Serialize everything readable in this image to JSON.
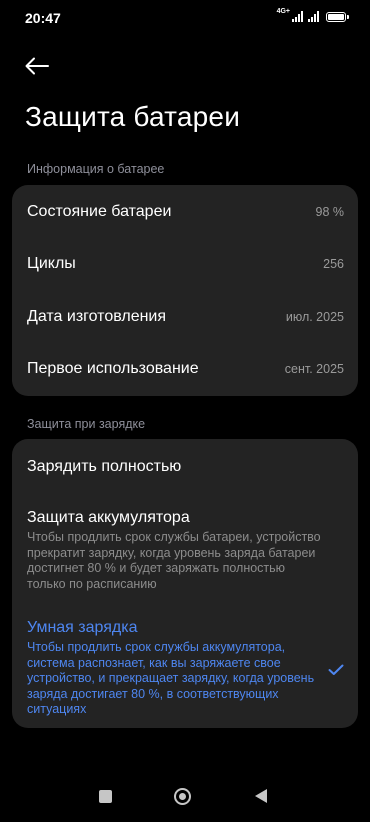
{
  "status_bar": {
    "time": "20:47",
    "network_label": "4G+"
  },
  "header": {
    "title": "Защита батареи"
  },
  "battery_info": {
    "section_title": "Информация о батарее",
    "rows": [
      {
        "label": "Состояние батареи",
        "value": "98 %"
      },
      {
        "label": "Циклы",
        "value": "256"
      },
      {
        "label": "Дата изготовления",
        "value": "июл. 2025"
      },
      {
        "label": "Первое использование",
        "value": "сент. 2025"
      }
    ]
  },
  "charging_protection": {
    "section_title": "Защита при зарядке",
    "options": [
      {
        "title": "Зарядить полностью",
        "description": "",
        "selected": false
      },
      {
        "title": "Защита аккумулятора",
        "description": "Чтобы продлить срок службы батареи, устройство прекратит зарядку, когда уровень заряда батареи достигнет 80 % и будет заряжать полностью только по расписанию",
        "selected": false
      },
      {
        "title": "Умная зарядка",
        "description": "Чтобы продлить срок службы аккумулятора, система распознает, как вы заряжаете свое устройство, и прекращает зарядку, когда уровень заряда достигает 80 %, в соответствующих ситуациях",
        "selected": true
      }
    ]
  },
  "colors": {
    "background": "#000000",
    "card": "#232323",
    "accent": "#4e86f0",
    "secondary_text": "#8c8c8c"
  },
  "icons": [
    "arrow-left-icon",
    "check-icon",
    "signal-icon",
    "battery-icon",
    "nav-recents-icon",
    "nav-home-icon",
    "nav-back-icon"
  ]
}
